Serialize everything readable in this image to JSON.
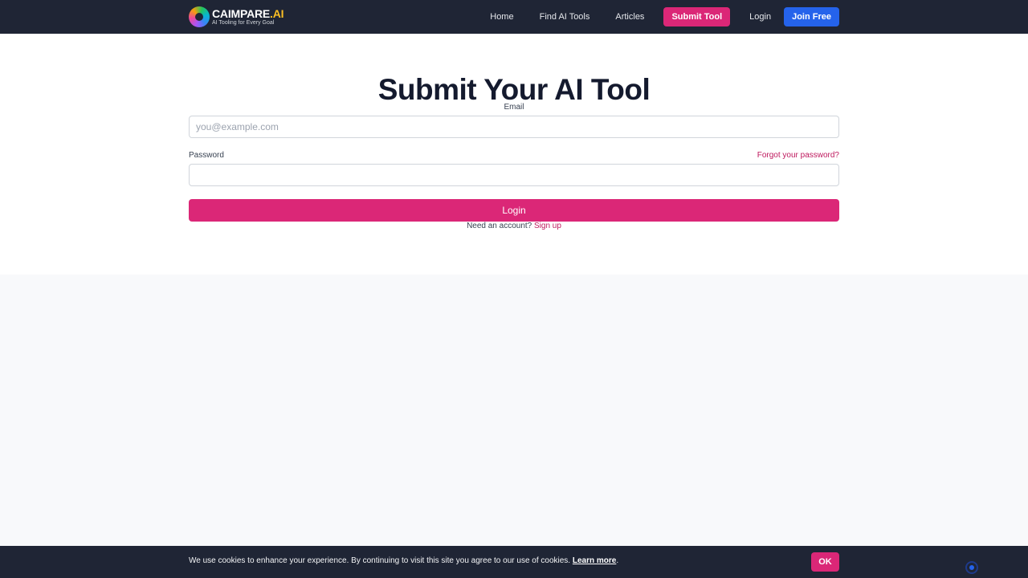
{
  "header": {
    "brand_name": "CAIMPARE",
    "brand_suffix": ".AI",
    "brand_tagline": "AI Tooling for Every Goal",
    "nav": {
      "home": "Home",
      "find_tools": "Find AI Tools",
      "articles": "Articles",
      "submit_tool": "Submit Tool",
      "login": "Login",
      "join_free": "Join Free"
    }
  },
  "main": {
    "title": "Submit Your AI Tool",
    "email_label": "Email",
    "email_placeholder": "you@example.com",
    "email_value": "",
    "password_label": "Password",
    "password_value": "",
    "forgot_password": "Forgot your password?",
    "login_button": "Login",
    "need_account": "Need an account?",
    "sign_up": "Sign up"
  },
  "cookie_banner": {
    "text": "We use cookies to enhance your experience. By continuing to visit this site you agree to our use of cookies.",
    "learn_more": "Learn more",
    "period": ".",
    "ok": "OK"
  },
  "colors": {
    "header_bg": "#1f2535",
    "accent_pink": "#db2777",
    "accent_blue": "#2563eb",
    "link_pink": "#be185d"
  },
  "icons": {
    "brand_logo": "swirl-logo-icon",
    "corner_badge": "recaptcha-badge-icon"
  }
}
